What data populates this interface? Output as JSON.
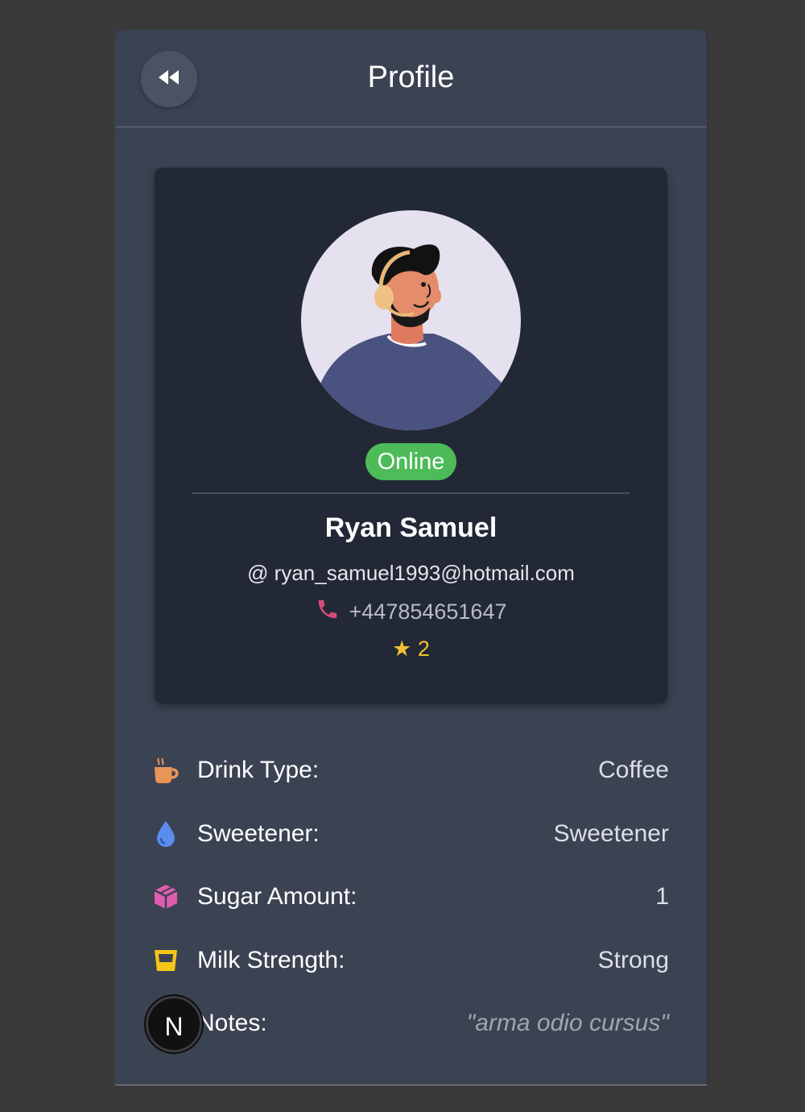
{
  "header": {
    "title": "Profile",
    "back_icon": "rewind-icon"
  },
  "profile": {
    "status": "Online",
    "name": "Ryan Samuel",
    "email": "@ ryan_samuel1993@hotmail.com",
    "phone": "+447854651647",
    "rating": "★ 2"
  },
  "preferences": [
    {
      "icon": "coffee-cup-icon",
      "label": "Drink Type:",
      "value": "Coffee"
    },
    {
      "icon": "droplet-icon",
      "label": "Sweetener:",
      "value": "Sweetener"
    },
    {
      "icon": "cube-icon",
      "label": "Sugar Amount:",
      "value": "1"
    },
    {
      "icon": "glass-icon",
      "label": "Milk Strength:",
      "value": "Strong"
    },
    {
      "icon": "notes-icon",
      "label": "Notes:",
      "value": "\"arma odio cursus\""
    }
  ],
  "floating_badge": "N",
  "colors": {
    "background": "#3b4252",
    "card": "#222835",
    "online": "#4cbb58",
    "star": "#f2c02e",
    "coffee": "#e9955a",
    "droplet": "#5b8def",
    "cube": "#e05cae",
    "glass": "#f5c518",
    "phone": "#d64a7b"
  }
}
